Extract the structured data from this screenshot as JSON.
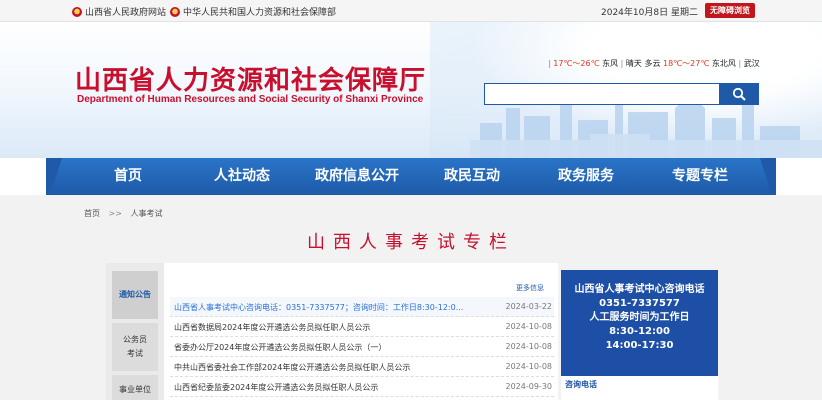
{
  "topbar": {
    "link1": "山西省人民政府网站",
    "link2": "中华人民共和国人力资源和社会保障部",
    "date": "2024年10月8日  星期二",
    "accessible": "无障碍浏览"
  },
  "header": {
    "title": "山西省人力资源和社会保障厅",
    "subtitle": "Department of Human Resources and Social Security of Shanxi Province",
    "weather": {
      "t1": "17℃～26℃",
      "c1": "东风",
      "loc": "晴天",
      "cond": "多云",
      "t2": "18℃～27℃",
      "c2": "东北风",
      "c3": "武汉",
      "extra": "武汉"
    },
    "search_placeholder": ""
  },
  "nav": {
    "items": [
      "首页",
      "人社动态",
      "政府信息公开",
      "政民互动",
      "政务服务",
      "专题专栏"
    ]
  },
  "breadcrumb": {
    "home": "首页",
    "sep": ">>",
    "current": "人事考试"
  },
  "section": {
    "title": "山西人事考试专栏"
  },
  "tabs": [
    {
      "label": "通知公告"
    },
    {
      "label": "公务员\n考试"
    },
    {
      "label": "事业单位"
    }
  ],
  "more_label": "更多信息",
  "news": [
    {
      "title": "山西省人事考试中心咨询电话：0351-7337577；咨询时间：工作日8:30-12:0...",
      "date": "2024-03-22"
    },
    {
      "title": "山西省数据局2024年度公开遴选公务员拟任职人员公示",
      "date": "2024-10-08"
    },
    {
      "title": "省委办公厅2024年度公开遴选公务员拟任职人员公示（一）",
      "date": "2024-10-08"
    },
    {
      "title": "中共山西省委社会工作部2024年度公开遴选公务员拟任职人员公示",
      "date": "2024-10-08"
    },
    {
      "title": "山西省纪委监委2024年度公开遴选公务员拟任职人员公示",
      "date": "2024-09-30"
    }
  ],
  "contact": {
    "line1": "山西省人事考试中心咨询电话",
    "line2": "0351-7337577",
    "line3": "人工服务时间为工作日",
    "line4": "8:30-12:00",
    "line5": "14:00-17:30",
    "tab": "咨询电话"
  },
  "colors": {
    "brand_red": "#c8102e",
    "brand_blue": "#1e5aa8"
  }
}
